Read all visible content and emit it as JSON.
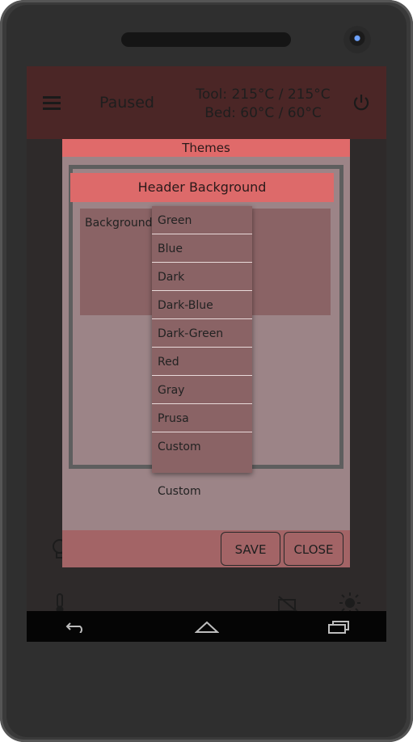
{
  "header": {
    "status": "Paused",
    "tool_temp": "Tool: 215°C / 215°C",
    "bed_temp": "Bed: 60°C / 60°C"
  },
  "dialog": {
    "title": "Themes",
    "section_title": "Header Background",
    "background_label": "Background",
    "custom_row_label": "Custom",
    "save_label": "SAVE",
    "close_label": "CLOSE"
  },
  "dropdown": {
    "options": [
      "Green",
      "Blue",
      "Dark",
      "Dark-Blue",
      "Dark-Green",
      "Red",
      "Gray",
      "Prusa",
      "Custom"
    ]
  },
  "icons": [
    "menu-icon",
    "power-icon",
    "lightbulb-icon",
    "thermometer-icon",
    "webcam-off-icon",
    "brightness-icon",
    "back-icon",
    "home-icon",
    "recent-apps-icon"
  ],
  "colors": {
    "header_bg": "#4b2626",
    "accent": "#dd6a6a",
    "dialog_bg": "#9c8487",
    "dropdown_bg": "#8a6365"
  }
}
